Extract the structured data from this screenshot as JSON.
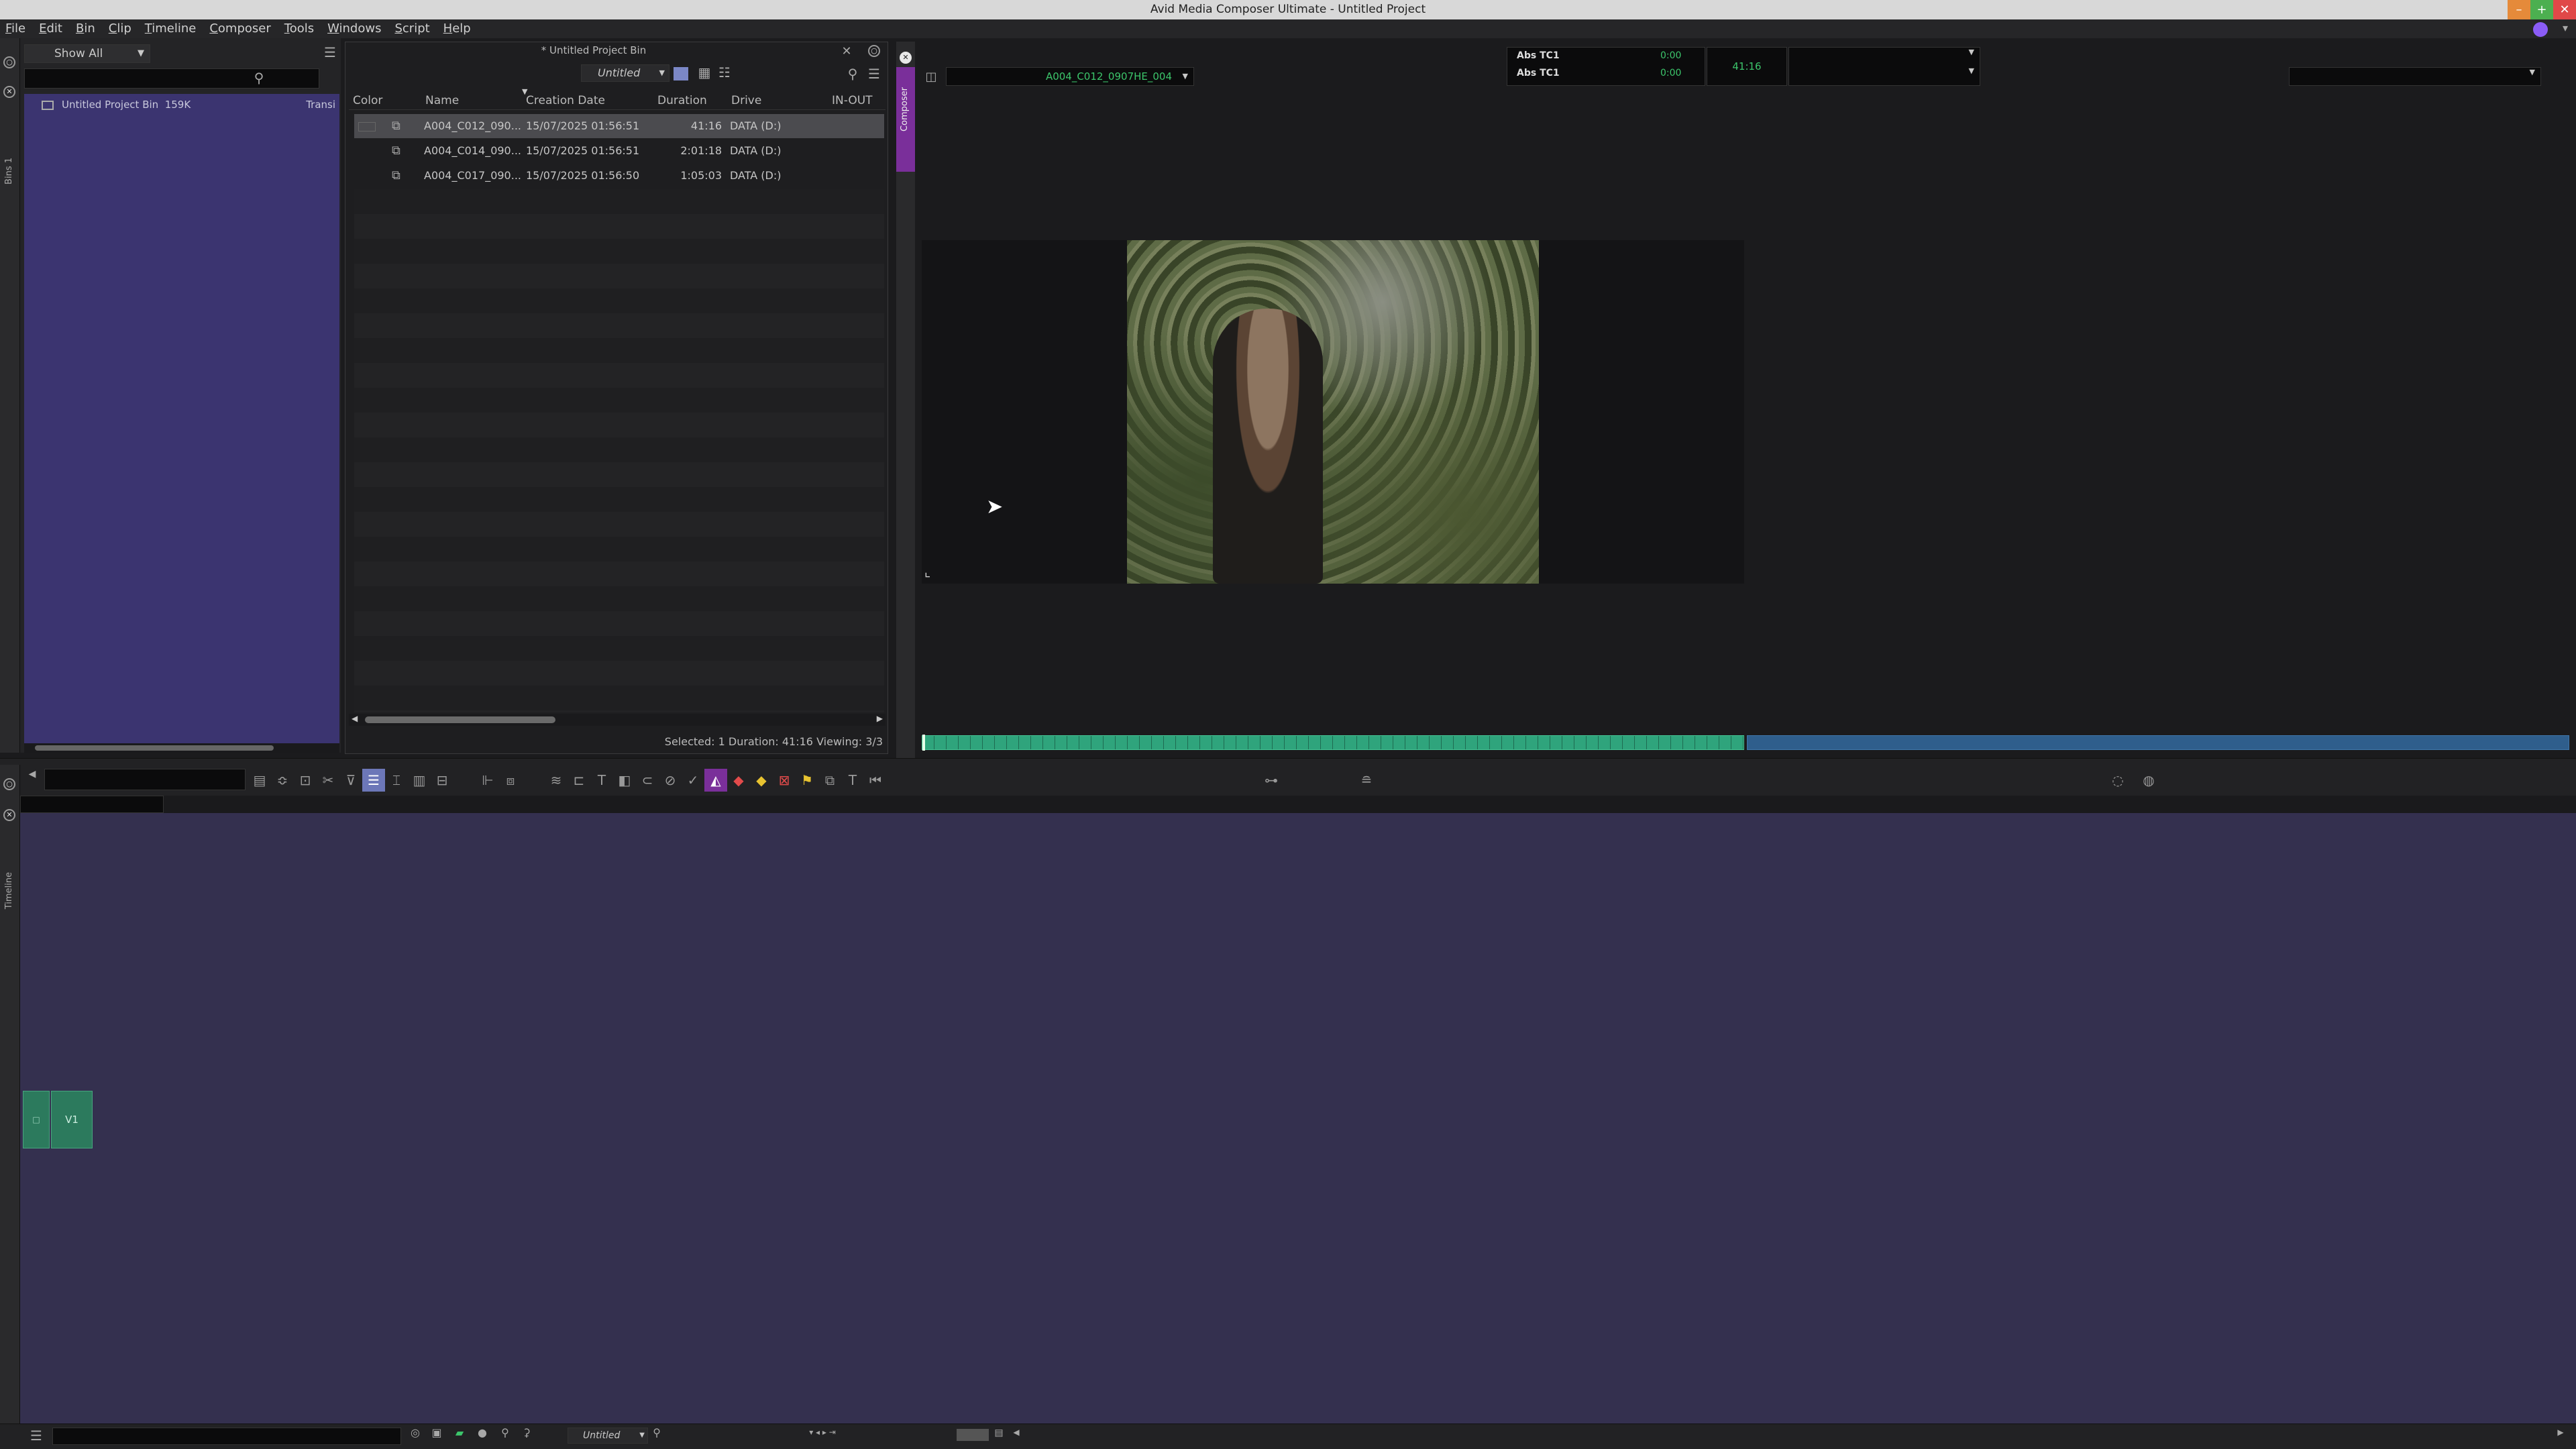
{
  "window": {
    "title": "Avid Media Composer Ultimate - Untitled Project"
  },
  "menu": [
    "File",
    "Edit",
    "Bin",
    "Clip",
    "Timeline",
    "Composer",
    "Tools",
    "Windows",
    "Script",
    "Help"
  ],
  "project": {
    "show_all": "Show All",
    "bin_item": "Untitled Project Bin",
    "bin_size": "159K",
    "truncated": "Transi",
    "side_tab": "Bins 1"
  },
  "bin": {
    "title": "* Untitled Project Bin",
    "view_name": "Untitled",
    "columns": [
      "Color",
      "Name",
      "Creation Date",
      "Duration",
      "Drive",
      "IN-OUT"
    ],
    "rows": [
      {
        "name": "A004_C012_090...",
        "date": "15/07/2025 01:56:51",
        "duration": "41:16",
        "drive": "DATA (D:)",
        "selected": true
      },
      {
        "name": "A004_C014_090...",
        "date": "15/07/2025 01:56:51",
        "duration": "2:01:18",
        "drive": "DATA (D:)",
        "selected": false
      },
      {
        "name": "A004_C017_090...",
        "date": "15/07/2025 01:56:50",
        "duration": "1:05:03",
        "drive": "DATA (D:)",
        "selected": false
      }
    ],
    "status": "Selected: 1  Duration: 41:16   Viewing: 3/3"
  },
  "composer": {
    "side_tab": "Composer",
    "clip_name": "A004_C012_0907HE_004",
    "tc_rows": [
      {
        "label": "Abs TC1",
        "value": "0:00"
      },
      {
        "label": "Abs TC1",
        "value": "0:00"
      }
    ],
    "center_tc": "41:16",
    "playhead_fraction": 0.0
  },
  "timeline": {
    "side_tab": "Timeline",
    "track_label": "V1",
    "footer_view": "Untitled"
  }
}
